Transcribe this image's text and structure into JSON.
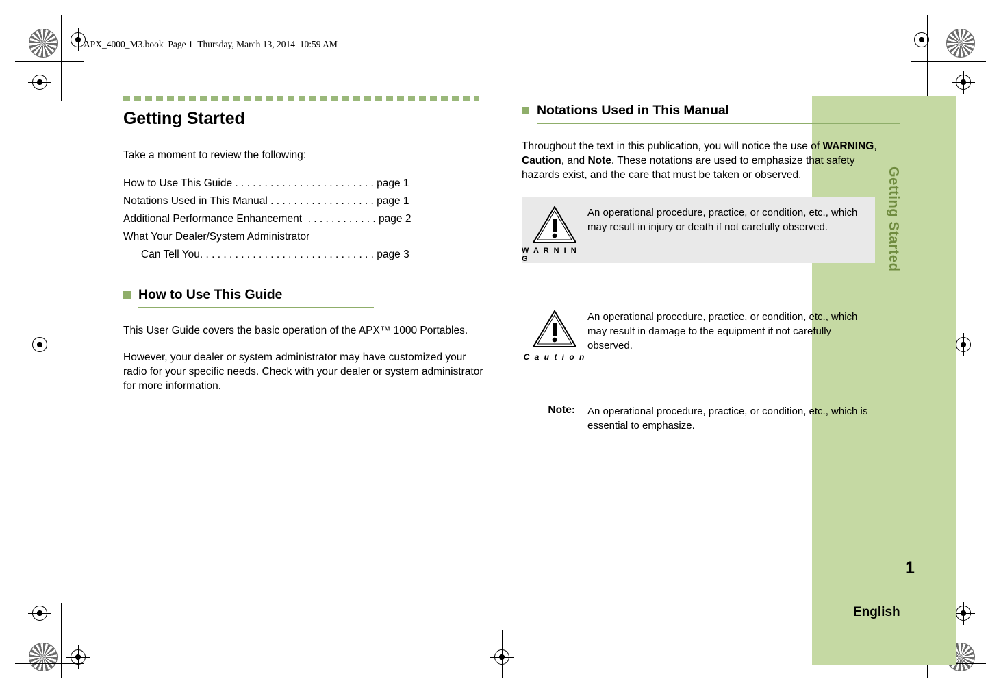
{
  "header": {
    "book_line": "APX_4000_M3.book  Page 1  Thursday, March 13, 2014  10:59 AM"
  },
  "left_column": {
    "chapter_title": "Getting Started",
    "intro": "Take a moment to review the following:",
    "toc": [
      {
        "text": "How to Use This Guide . . . . . . . . . . . . . . . . . . . . . . . . page 1",
        "indent": false
      },
      {
        "text": "Notations Used in This Manual . . . . . . . . . . . . . . . . . . page 1",
        "indent": false
      },
      {
        "text": "Additional Performance Enhancement  . . . . . . . . . . . . page 2",
        "indent": false
      },
      {
        "text": "What Your Dealer/System Administrator",
        "indent": false
      },
      {
        "text": "Can Tell You. . . . . . . . . . . . . . . . . . . . . . . . . . . . . . page 3",
        "indent": true
      }
    ],
    "section_title": "How to Use This Guide",
    "paragraphs": [
      "This User Guide covers the basic operation of the APX™ 1000 Portables.",
      "However, your dealer or system administrator may have customized your radio for your specific needs. Check with your dealer or system administrator for more information."
    ]
  },
  "right_column": {
    "section_title": "Notations Used in This Manual",
    "intro_part1": "Throughout the text in this publication, you will notice the use of ",
    "intro_b1": "WARNING",
    "intro_part2": ", ",
    "intro_b2": "Caution",
    "intro_part3": ", and ",
    "intro_b3": "Note",
    "intro_part4": ". These notations are used to emphasize that safety hazards exist, and the care that must be taken or observed.",
    "warning": {
      "label": "W A R N I N G",
      "text": "An operational procedure, practice, or condition, etc., which may result in injury or death if not carefully observed."
    },
    "caution": {
      "label": "C a u t i o n",
      "text": "An operational procedure, practice, or condition, etc., which may result in damage to the equipment if not carefully observed."
    },
    "note": {
      "label": "Note:",
      "text": "An operational procedure, practice, or condition, etc., which is essential to emphasize."
    }
  },
  "side_tab": {
    "title": "Getting Started",
    "page_number": "1",
    "language": "English"
  },
  "colors": {
    "accent_green": "#8fae6a",
    "tab_green": "#c5d9a3",
    "tab_title_green": "#6f8b3f",
    "warning_bg": "#e9e9e9"
  }
}
